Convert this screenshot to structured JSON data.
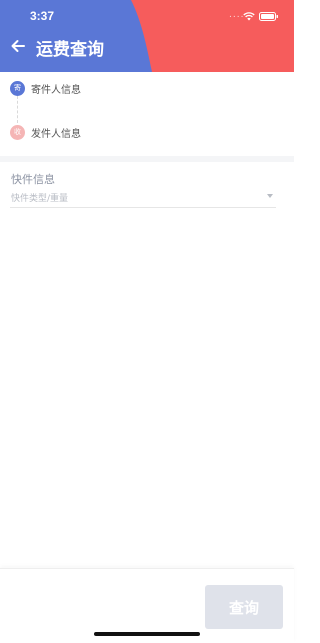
{
  "status_bar": {
    "time": "3:37",
    "signal_text": "....",
    "wifi_icon": "wifi-icon",
    "battery_icon": "battery-icon"
  },
  "header": {
    "title": "运费查询",
    "back_icon": "arrow-left-icon",
    "primary_color": "#5a77d6",
    "accent_color": "#f65c5c"
  },
  "address": {
    "sender": {
      "badge": "寄",
      "label": "寄件人信息"
    },
    "receiver": {
      "badge": "收",
      "label": "发件人信息"
    }
  },
  "package": {
    "title": "快件信息",
    "placeholder": "快件类型/重量"
  },
  "footer": {
    "query_label": "查询",
    "query_disabled_color": "#dfe2ea"
  }
}
